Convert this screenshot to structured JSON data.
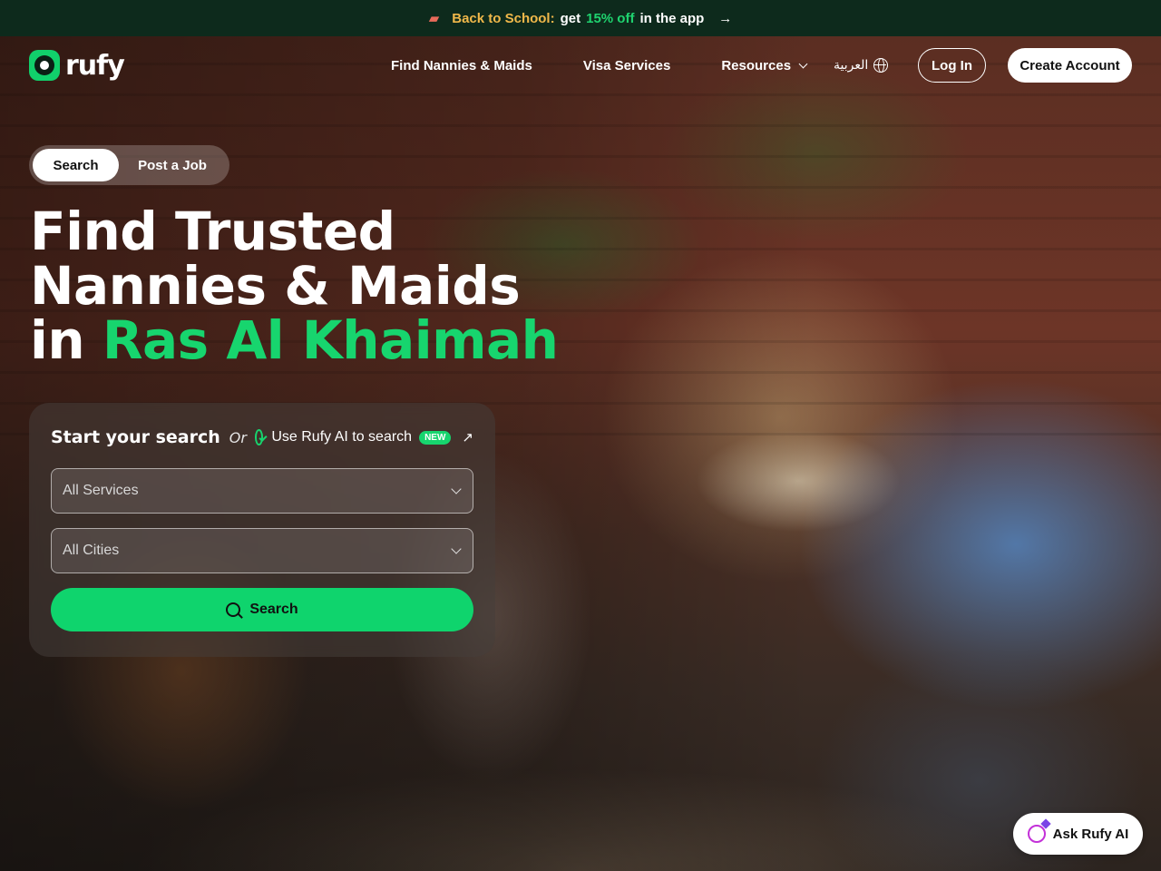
{
  "promo": {
    "highlight": "Back to School:",
    "text_before": "get",
    "discount": "15% off",
    "text_after": "in the app",
    "arrow": "→"
  },
  "header": {
    "logo_text": "rufy",
    "nav": {
      "find": "Find Nannies & Maids",
      "visa": "Visa Services",
      "resources": "Resources"
    },
    "language": "العربية",
    "login": "Log In",
    "create_account": "Create Account"
  },
  "tabs": {
    "search": "Search",
    "post_job": "Post a Job"
  },
  "hero": {
    "line1": "Find Trusted",
    "line2": "Nannies & Maids",
    "line3_prefix": "in",
    "city": "Ras Al Khaimah"
  },
  "search_card": {
    "title": "Start your search",
    "or": "Or",
    "ai_label": "Use Rufy AI to search",
    "badge": "NEW",
    "services_placeholder": "All Services",
    "cities_placeholder": "All Cities",
    "search_button": "Search"
  },
  "ask_ai": "Ask Rufy AI",
  "colors": {
    "accent": "#17d56e",
    "promo_bg": "#0d2a1c",
    "promo_highlight": "#f0b84a"
  },
  "icons": {
    "promo": "backpack-icon",
    "language": "globe-icon",
    "ai": "ai-search-icon",
    "external": "external-arrow-icon",
    "search": "search-icon",
    "ask": "chat-sparkle-icon"
  }
}
